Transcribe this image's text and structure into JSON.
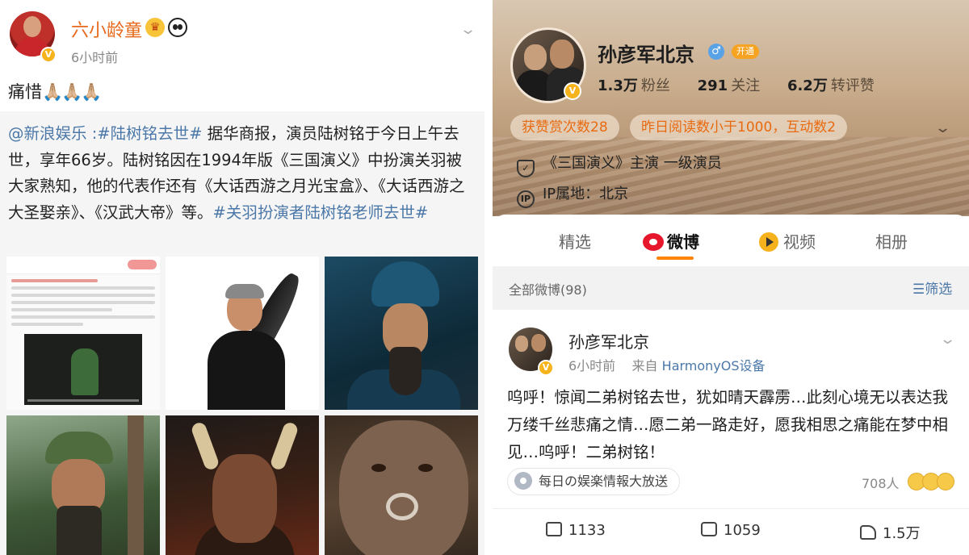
{
  "left_post": {
    "author": "六小龄童",
    "time": "6小时前",
    "text": "痛惜",
    "emoji": "🙏🏼🙏🏼🙏🏼",
    "repost": {
      "mention": "@新浪娱乐",
      "sep": " :",
      "topic1": "#陆树铭去世#",
      "body": " 据华商报，演员陆树铭于今日上午去世，享年66岁。陆树铭因在1994年版《三国演义》中扮演关羽被大家熟知，他的代表作还有《大话西游之月光宝盒》、《大话西游之大圣娶亲》、《汉武大帝》等。",
      "topic2": "#关羽扮演者陆树铭老师去世#"
    }
  },
  "profile": {
    "name": "孙彦军北京",
    "badge": "开通",
    "stats": [
      {
        "value": "1.3万",
        "label": "粉丝"
      },
      {
        "value": "291",
        "label": "关注"
      },
      {
        "value": "6.2万",
        "label": "转评赞"
      }
    ],
    "tags": [
      "获赞赏次数28",
      "昨日阅读数小于1000，互动数2"
    ],
    "verify": "《三国演义》主演 一级演员",
    "ip": "IP属地：北京",
    "ip_icon": "IP"
  },
  "tabs": [
    "精选",
    "微博",
    "视频",
    "相册"
  ],
  "feed": {
    "all_label": "全部微博(98)",
    "filter_label": "筛选"
  },
  "post": {
    "author": "孙彦军北京",
    "time": "6小时前",
    "source_prefix": "来自",
    "source": "HarmonyOS设备",
    "text": "呜呼！惊闻二弟树铭去世，犹如晴天霹雳…此刻心境无以表达我万缕千丝悲痛之情…愿二弟一路走好，愿我相思之痛能在梦中相见…呜呼！二弟树铭！",
    "topic": "每日の娱楽情報大放送",
    "reactions": "708人",
    "reposts": "1133",
    "comments": "1059",
    "likes": "1.5万"
  },
  "colors": {
    "orange": "#ff8200",
    "link": "#4b78a8",
    "left_name": "#e8681a"
  }
}
